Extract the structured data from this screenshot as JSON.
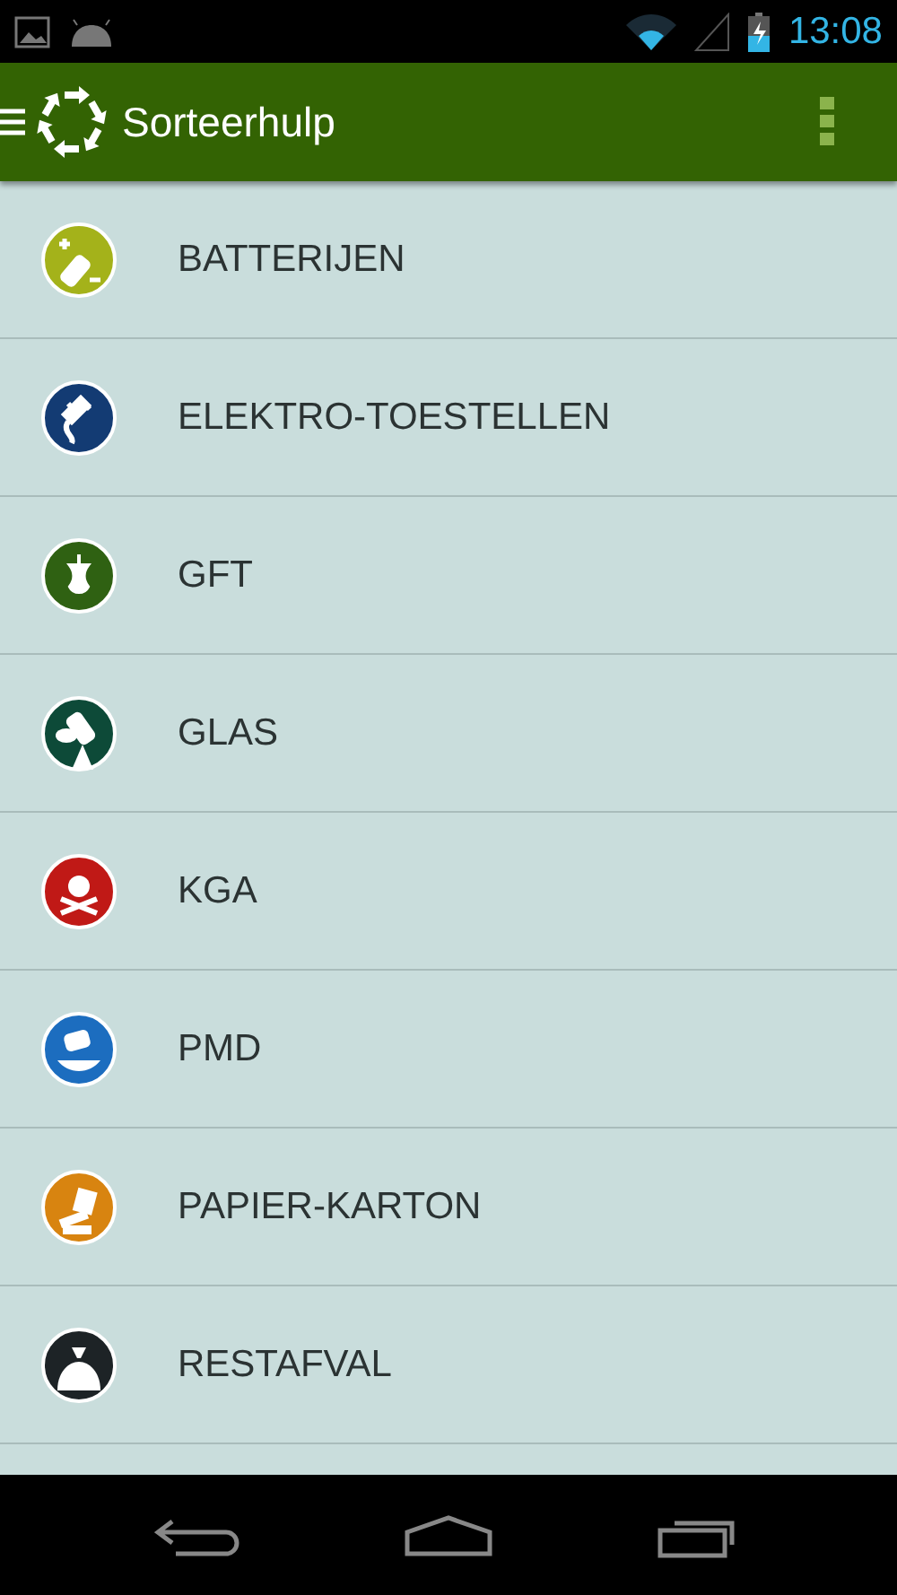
{
  "status_bar": {
    "time": "13:08"
  },
  "app_bar": {
    "title": "Sorteerhulp"
  },
  "categories": [
    {
      "label": "BATTERIJEN",
      "kind": "battery",
      "color": "#a4b21a"
    },
    {
      "label": "ELEKTRO-TOESTELLEN",
      "kind": "plug",
      "color": "#133b73"
    },
    {
      "label": "GFT",
      "kind": "apple",
      "color": "#2f6112"
    },
    {
      "label": "GLAS",
      "kind": "bottle",
      "color": "#0d4a38"
    },
    {
      "label": "KGA",
      "kind": "skull",
      "color": "#c01916"
    },
    {
      "label": "PMD",
      "kind": "can",
      "color": "#1c6dbf"
    },
    {
      "label": "PAPIER-KARTON",
      "kind": "paper",
      "color": "#d88410"
    },
    {
      "label": "RESTAFVAL",
      "kind": "bag",
      "color": "#1d2326"
    }
  ]
}
